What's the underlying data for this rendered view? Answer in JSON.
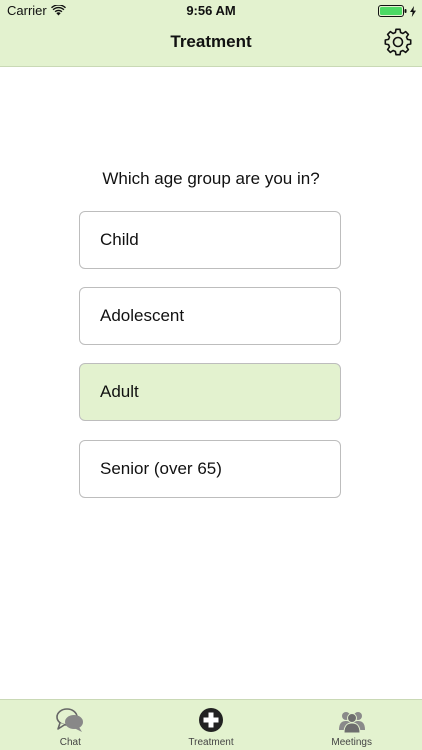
{
  "status_bar": {
    "carrier": "Carrier",
    "time": "9:56 AM"
  },
  "nav": {
    "title": "Treatment",
    "settings_icon": "gear-icon"
  },
  "question": "Which age group are you in?",
  "options": [
    {
      "label": "Child",
      "selected": false
    },
    {
      "label": "Adolescent",
      "selected": false
    },
    {
      "label": "Adult",
      "selected": true
    },
    {
      "label": "Senior (over 65)",
      "selected": false
    }
  ],
  "tab_bar": {
    "tabs": [
      {
        "label": "Chat",
        "icon": "chat-icon"
      },
      {
        "label": "Treatment",
        "icon": "plus-circle-icon",
        "active": true
      },
      {
        "label": "Meetings",
        "icon": "people-icon"
      }
    ]
  },
  "colors": {
    "header_bg": "#e3f2cf",
    "selected_bg": "#e3f2cf",
    "battery": "#4cd964"
  }
}
